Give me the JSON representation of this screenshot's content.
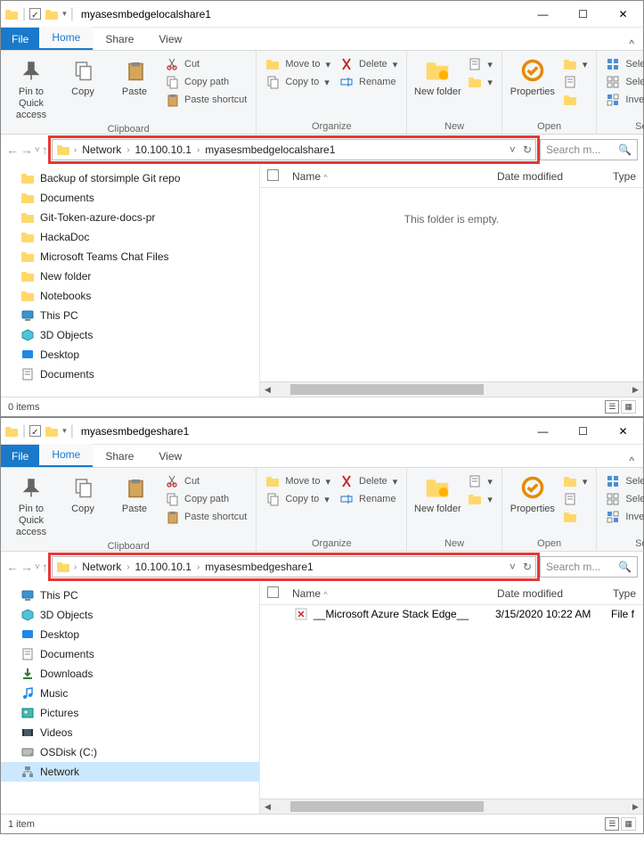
{
  "windows": [
    {
      "title": "myasesmbedgelocalshare1",
      "tabs": {
        "file": "File",
        "home": "Home",
        "share": "Share",
        "view": "View"
      },
      "ribbon": {
        "clipboard": {
          "pin": "Pin to Quick access",
          "copy": "Copy",
          "paste": "Paste",
          "cut": "Cut",
          "copypath": "Copy path",
          "pasteshortcut": "Paste shortcut",
          "label": "Clipboard"
        },
        "organize": {
          "moveto": "Move to",
          "copyto": "Copy to",
          "delete": "Delete",
          "rename": "Rename",
          "label": "Organize"
        },
        "new": {
          "newfolder": "New folder",
          "label": "New"
        },
        "open": {
          "properties": "Properties",
          "label": "Open"
        },
        "select": {
          "all": "Select all",
          "none": "Select none",
          "invert": "Invert selection",
          "label": "Select"
        }
      },
      "breadcrumb": [
        "Network",
        "10.100.10.1",
        "myasesmbedgelocalshare1"
      ],
      "search_placeholder": "Search m...",
      "nav_items": [
        {
          "label": "Backup of storsimple Git repo",
          "kind": "folder"
        },
        {
          "label": "Documents",
          "kind": "folder"
        },
        {
          "label": "Git-Token-azure-docs-pr",
          "kind": "folder"
        },
        {
          "label": "HackaDoc",
          "kind": "folder"
        },
        {
          "label": "Microsoft Teams Chat Files",
          "kind": "folder"
        },
        {
          "label": "New folder",
          "kind": "folder"
        },
        {
          "label": "Notebooks",
          "kind": "folder"
        },
        {
          "label": "This PC",
          "kind": "pc"
        },
        {
          "label": "3D Objects",
          "kind": "3d"
        },
        {
          "label": "Desktop",
          "kind": "desktop"
        },
        {
          "label": "Documents",
          "kind": "docs"
        }
      ],
      "columns": {
        "name": "Name",
        "date": "Date modified",
        "type": "Type"
      },
      "empty_msg": "This folder is empty.",
      "status": "0 items"
    },
    {
      "title": "myasesmbedgeshare1",
      "tabs": {
        "file": "File",
        "home": "Home",
        "share": "Share",
        "view": "View"
      },
      "ribbon": {
        "clipboard": {
          "pin": "Pin to Quick access",
          "copy": "Copy",
          "paste": "Paste",
          "cut": "Cut",
          "copypath": "Copy path",
          "pasteshortcut": "Paste shortcut",
          "label": "Clipboard"
        },
        "organize": {
          "moveto": "Move to",
          "copyto": "Copy to",
          "delete": "Delete",
          "rename": "Rename",
          "label": "Organize"
        },
        "new": {
          "newfolder": "New folder",
          "label": "New"
        },
        "open": {
          "properties": "Properties",
          "label": "Open"
        },
        "select": {
          "all": "Select all",
          "none": "Select none",
          "invert": "Invert selection",
          "label": "Select"
        }
      },
      "breadcrumb": [
        "Network",
        "10.100.10.1",
        "myasesmbedgeshare1"
      ],
      "search_placeholder": "Search m...",
      "nav_items": [
        {
          "label": "This PC",
          "kind": "pc"
        },
        {
          "label": "3D Objects",
          "kind": "3d"
        },
        {
          "label": "Desktop",
          "kind": "desktop"
        },
        {
          "label": "Documents",
          "kind": "docs"
        },
        {
          "label": "Downloads",
          "kind": "downloads"
        },
        {
          "label": "Music",
          "kind": "music"
        },
        {
          "label": "Pictures",
          "kind": "pictures"
        },
        {
          "label": "Videos",
          "kind": "videos"
        },
        {
          "label": "OSDisk (C:)",
          "kind": "disk"
        },
        {
          "label": "Network",
          "kind": "network",
          "selected": true
        }
      ],
      "columns": {
        "name": "Name",
        "date": "Date modified",
        "type": "Type"
      },
      "files": [
        {
          "name": "__Microsoft Azure Stack Edge__",
          "date": "3/15/2020 10:22 AM",
          "type": "File f"
        }
      ],
      "status": "1 item"
    }
  ]
}
